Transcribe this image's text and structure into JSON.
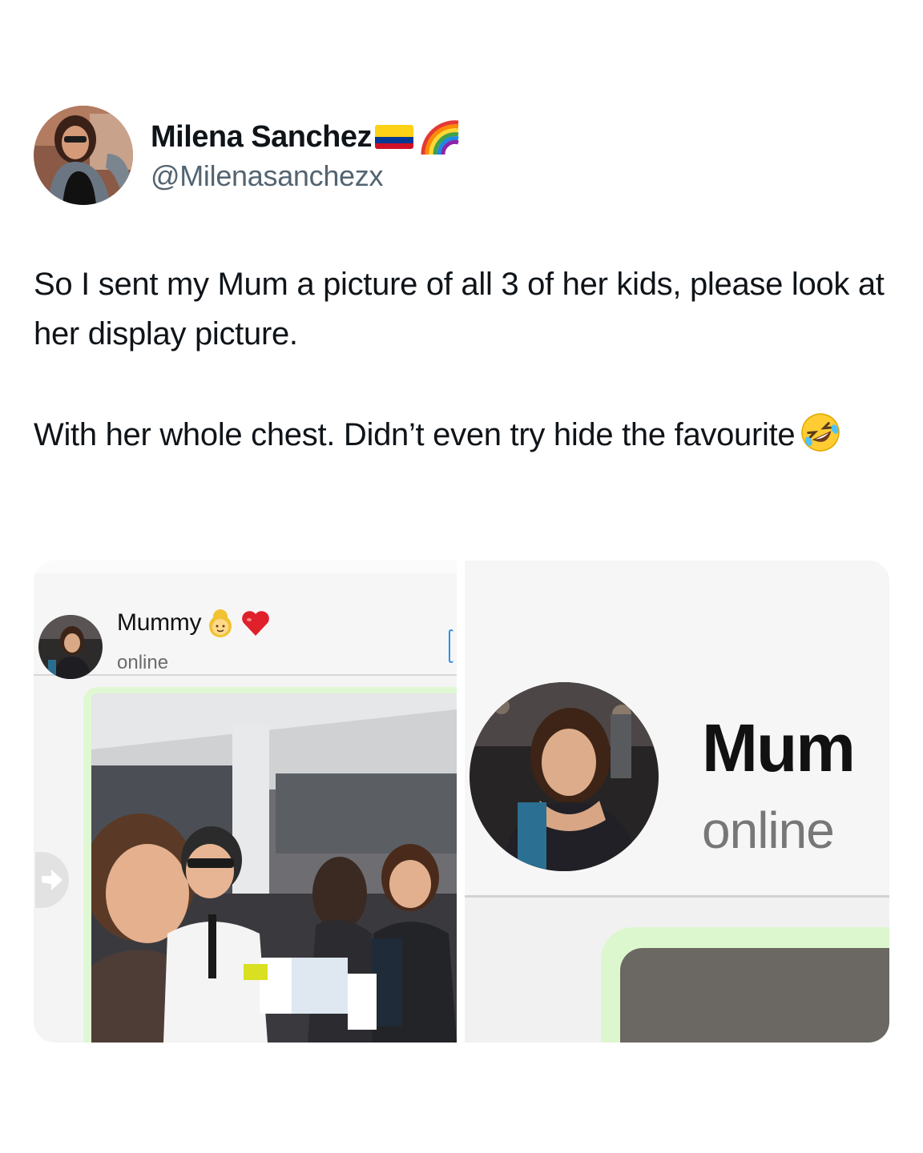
{
  "tweet": {
    "display_name": "Milena Sanchez",
    "handle": "@Milenasanchezx",
    "text_line1": "So I sent my Mum a picture of all 3 of her kids, please look at her display picture.",
    "text_line2": "With her whole chest. Didn’t even try hide the favourite",
    "name_emojis": [
      "colombia-flag-icon",
      "rainbow-icon"
    ],
    "text_emoji": "rofl-emoji-icon"
  },
  "screenshot_left": {
    "contact_name": "Mummy",
    "contact_emojis": [
      "older-woman-emoji-icon",
      "red-heart-icon"
    ],
    "status": "online"
  },
  "screenshot_right": {
    "contact_name": "Mum",
    "status": "online"
  },
  "colors": {
    "text_primary": "#0f1419",
    "text_secondary": "#536471",
    "bubble_green": "#dff8d3"
  }
}
